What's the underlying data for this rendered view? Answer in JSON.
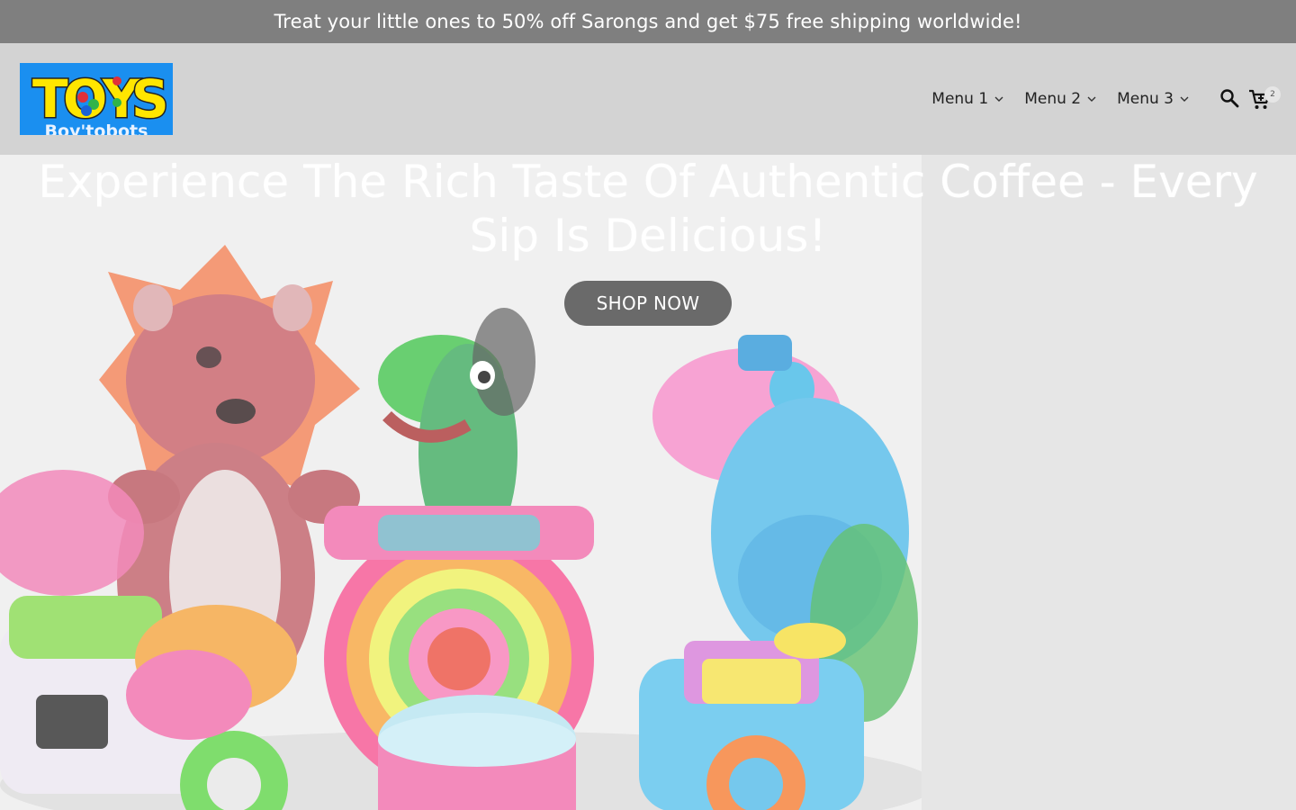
{
  "announcement": {
    "text": "Treat your little ones to 50% off Sarongs and get $75 free shipping worldwide!"
  },
  "logo": {
    "text": "TOYS",
    "subtext": "Boy'tobots"
  },
  "nav": {
    "items": [
      {
        "label": "Menu 1",
        "icon": "chevron-down-icon"
      },
      {
        "label": "Menu 2",
        "icon": "chevron-down-icon"
      },
      {
        "label": "Menu 3",
        "icon": "chevron-down-icon"
      }
    ],
    "search_icon": "search-icon",
    "cart_icon": "cart-icon",
    "cart_count": "2"
  },
  "hero": {
    "title": "Experience The Rich Taste Of Authentic Coffee - Every Sip Is Delicious!",
    "cta_label": "SHOP NOW",
    "image": "colorful-toys-image"
  },
  "colors": {
    "announcement_bg": "#7f7f7f",
    "header_bg": "#d3d3d3",
    "logo_bg": "#1a8ff0",
    "cta_bg": "#6a6a6a"
  }
}
